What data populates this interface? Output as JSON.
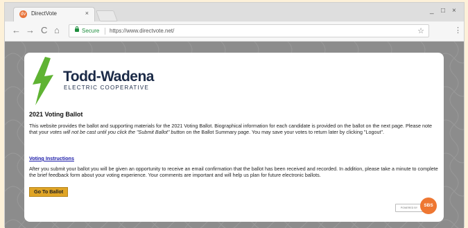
{
  "browser": {
    "tab_title": "DirectVote",
    "tab_close": "×",
    "favicon_text": "dv",
    "window_controls": {
      "minimize": "_",
      "maximize": "□",
      "close": "×"
    },
    "nav": {
      "back": "←",
      "forward": "→",
      "reload": "C",
      "home": "⌂"
    },
    "address": {
      "secure_label": "Secure",
      "url": "https://www.directvote.net/"
    },
    "bookmark_star": "☆",
    "menu_icon": "⋮"
  },
  "page": {
    "logo": {
      "name": "Todd-Wadena",
      "subtitle": "ELECTRIC COOPERATIVE",
      "bolt_color": "#5fb333"
    },
    "title": "2021 Voting Ballot",
    "intro_start": "This website provides the ballot and supporting materials for the 2021 Voting Ballot. Biographical information for each candidate is provided on the ballot on the next page. Please note that your ",
    "intro_emphasis": "votes will not be cast until you click the \"Submit Ballot\" button",
    "intro_end": " on the Ballot Summary page. You may save your votes to return later by clicking \"Logout\".",
    "voting_instructions_link": "Voting Instructions",
    "confirmation_text": "After you submit your ballot you will be given an opportunity to receive an email confirmation that the ballot has been received and recorded. In addition, please take a minute to complete the brief feedback form about your voting experience. Your comments are important and will help us plan for future electronic ballots.",
    "go_to_ballot_button": "Go To Ballot",
    "powered_by": "POWERED BY",
    "sbs_logo": "SBS"
  },
  "colors": {
    "accent_button": "#e0a526",
    "link": "#1a1aa8",
    "secure_green": "#1e8e3e",
    "sbs_orange": "#ee7732",
    "page_background": "#8c8c8c"
  }
}
